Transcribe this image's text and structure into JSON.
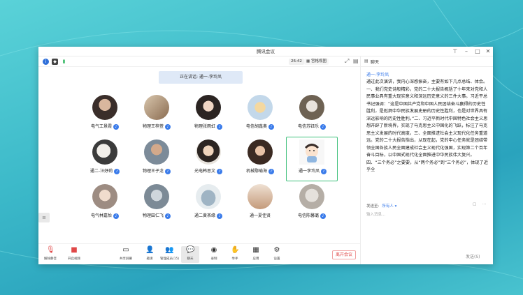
{
  "window": {
    "title": "腾讯会议"
  },
  "toolbar": {
    "time": "26:42",
    "view_label": "宫格视图"
  },
  "speaking": "正在讲话: 通一-李玲凤",
  "participants": [
    {
      "name": "电气工景霞",
      "mic": true
    },
    {
      "name": "物理王梓萱",
      "mic": true
    },
    {
      "name": "物理张雨虹",
      "mic": true
    },
    {
      "name": "电信胡鑫奥",
      "mic": true
    },
    {
      "name": "电信苏钰乐",
      "mic": true
    },
    {
      "name": "通二-汪妤莉",
      "mic": true
    },
    {
      "name": "物理王子龙",
      "mic": true
    },
    {
      "name": "光电韩思文",
      "mic": true
    },
    {
      "name": "机械鄢瑜海",
      "mic": true
    },
    {
      "name": "通一李玲凤",
      "mic": true
    },
    {
      "name": "电气林嘉怡",
      "mic": true
    },
    {
      "name": "物理田仁飞",
      "mic": true
    },
    {
      "name": "通二黄茶缘",
      "mic": true
    },
    {
      "name": "通一夏佳贤",
      "mic": false
    },
    {
      "name": "电信陈馨璐",
      "mic": true
    }
  ],
  "bottombar": {
    "items": [
      {
        "label": "解除静音",
        "icon": "mic-muted-icon"
      },
      {
        "label": "开启视频",
        "icon": "camera-off-icon"
      },
      {
        "label": "共享屏幕",
        "icon": "share-screen-icon"
      },
      {
        "label": "邀请",
        "icon": "invite-icon"
      },
      {
        "label": "管理成员(15)",
        "icon": "members-icon"
      },
      {
        "label": "聊天",
        "icon": "chat-icon"
      },
      {
        "label": "录制",
        "icon": "record-icon"
      },
      {
        "label": "举手",
        "icon": "hand-icon"
      },
      {
        "label": "应用",
        "icon": "apps-icon"
      },
      {
        "label": "设置",
        "icon": "settings-icon"
      }
    ],
    "leave_label": "离开会议"
  },
  "chat": {
    "title": "聊天",
    "sender": "通一-李玲凤",
    "message": "通过此次演讲，我内心深感振奋，主要有如下几点总结、体会。一、我们党史诗般精彩，党的二十大报告概括了十年来对党和人民事业具有重大现实意义和深远历史意义的三件大事。习近平总书记强调：“这是中国共产党和中国人民团结奋斗赢得的历史性胜利，是彪炳中华民族发展史册的历史性胜利，也是对世界具有深远影响的历史性胜利。”二、习近平新时代中国特色社会主义思想开辟了新境界，实现了马克思主义中国化的飞跃，标注了马克思主义发展的时代高度。三、全面推进社会主义现代化任务重道远。党的二十大报告指出，从现在起，党的中心任务就是团结带领全国各族人民全面建成社会主义现代化强国，实现第二个百年奋斗目标，以中国式现代化全面推进中华民族伟大复兴。四、“三个务必”之要要，从“两个务必”到“三个务必”，体现了近乎全",
    "send_to_label": "发送至:",
    "send_to_value": "所有人",
    "input_placeholder": "输入消息...",
    "send_label": "发送(S)"
  }
}
